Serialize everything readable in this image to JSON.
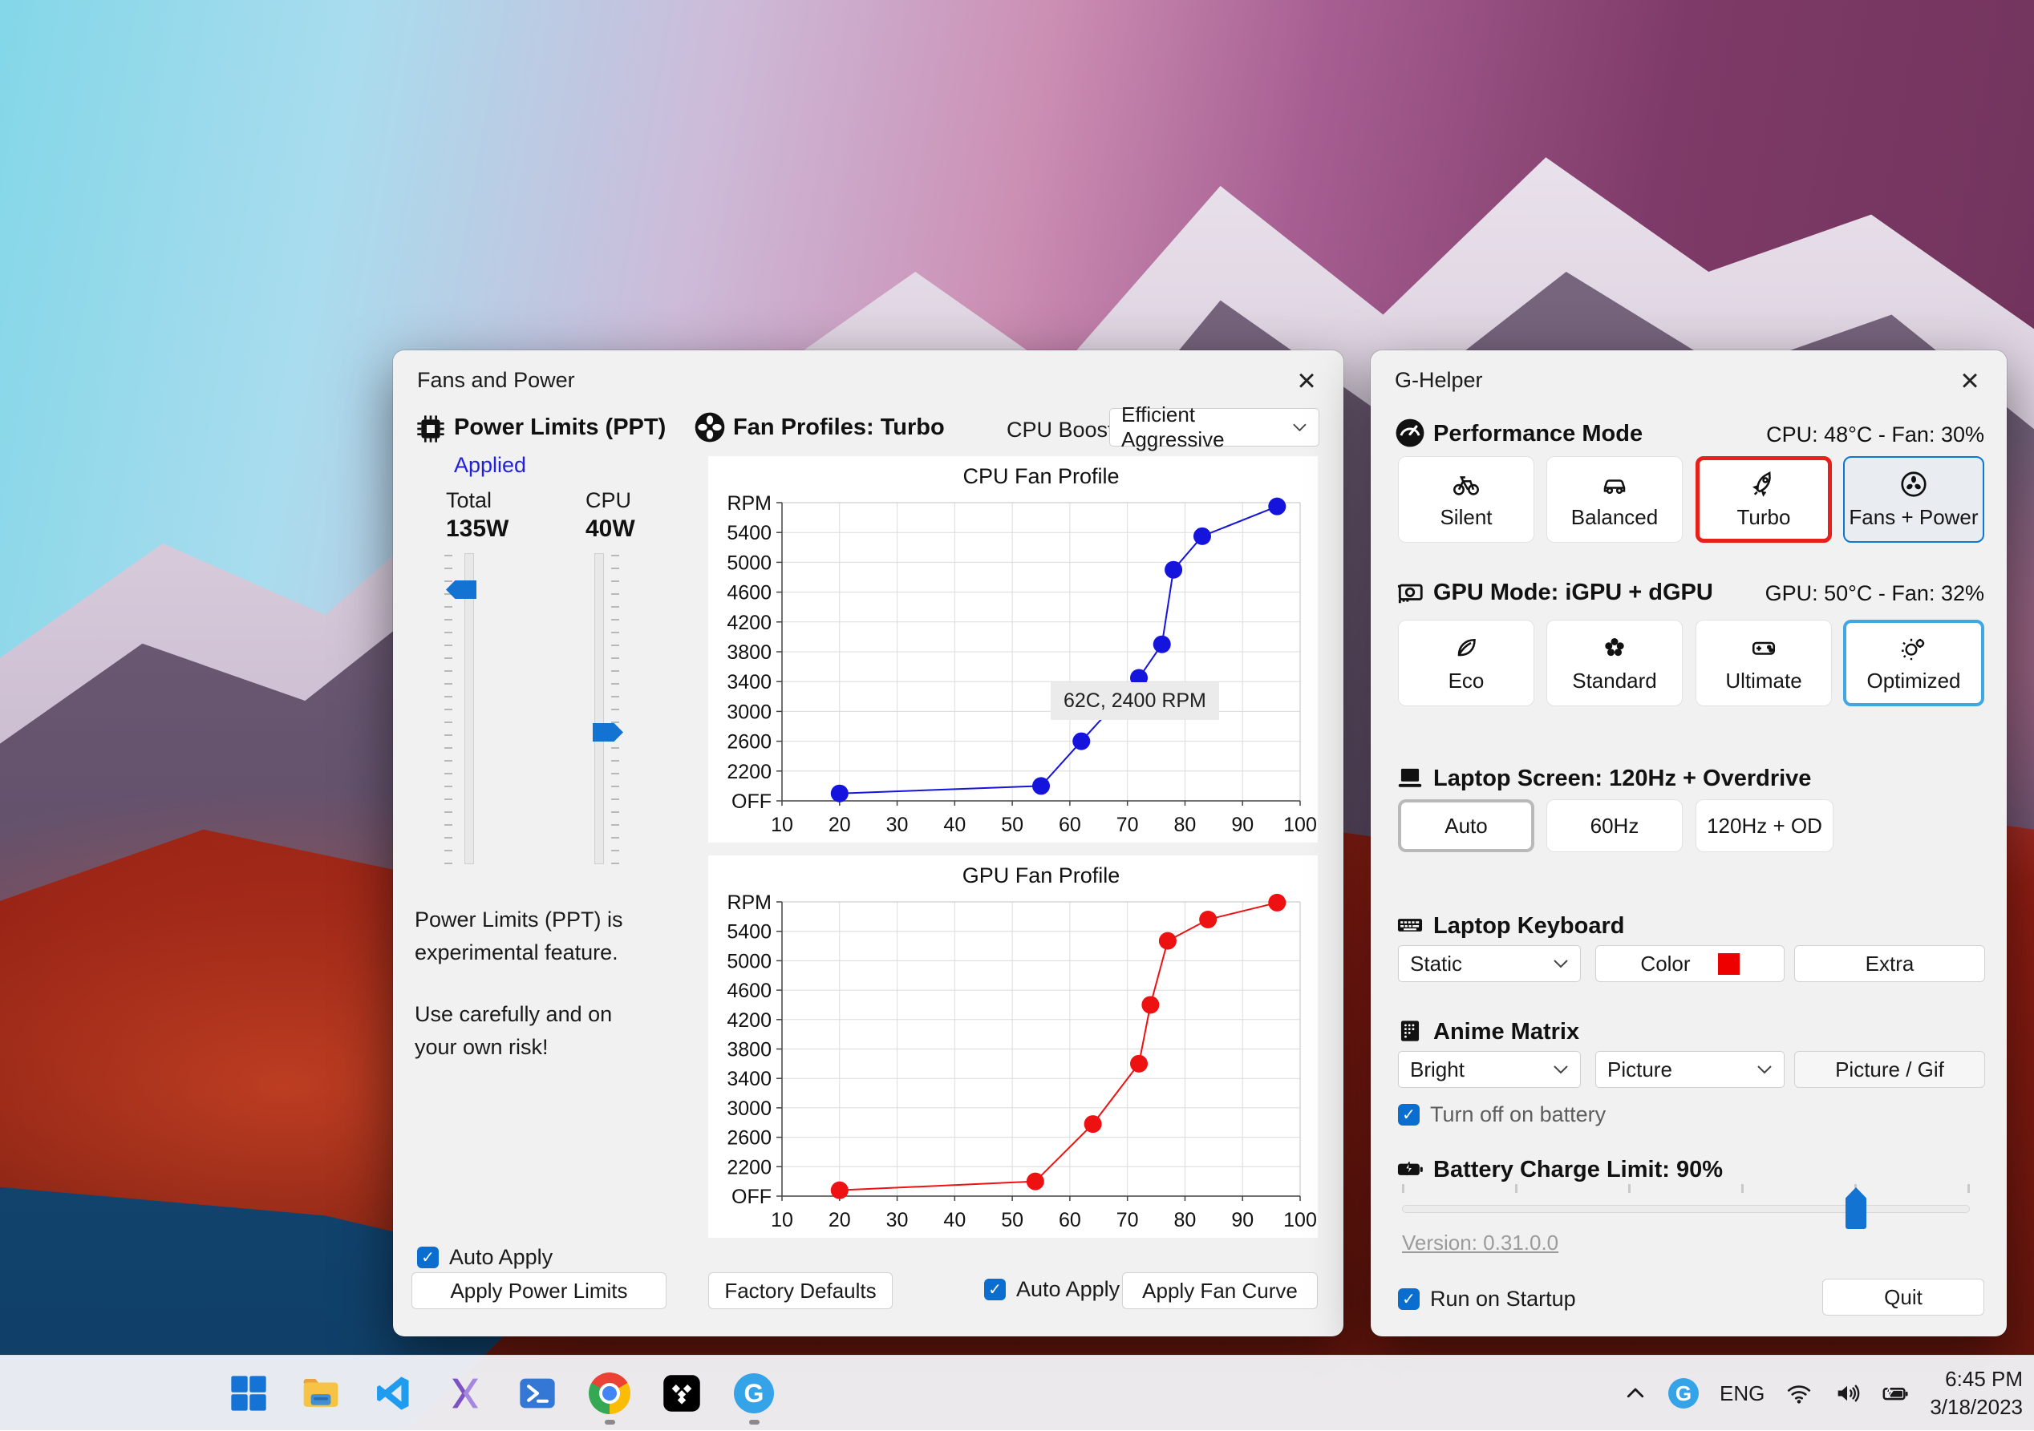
{
  "fans_window": {
    "title": "Fans and Power",
    "close": "×",
    "power_limits": {
      "heading": "Power Limits (PPT)",
      "status": "Applied",
      "total_label": "Total",
      "total_value": "135W",
      "cpu_label": "CPU",
      "cpu_value": "40W",
      "note1": "Power Limits (PPT) is experimental feature.",
      "note2": "Use carefully and on your own risk!",
      "auto_apply_label": "Auto Apply",
      "apply_button": "Apply Power Limits"
    },
    "fan_profiles": {
      "heading": "Fan Profiles: Turbo",
      "cpu_boost_label": "CPU Boost",
      "cpu_boost_value": "Efficient Aggressive",
      "factory_defaults_button": "Factory Defaults",
      "auto_apply_label": "Auto Apply",
      "apply_button": "Apply Fan Curve"
    }
  },
  "chart_data": [
    {
      "type": "line",
      "title": "CPU Fan Profile",
      "color": "#1414dc",
      "x": [
        20,
        55,
        62,
        72,
        76,
        78,
        83,
        96
      ],
      "y": [
        1900,
        2000,
        2600,
        3450,
        3900,
        4900,
        5350,
        5750
      ],
      "xlim": [
        10,
        100
      ],
      "ylim": [
        1800,
        5800
      ],
      "x_ticks": [
        10,
        20,
        30,
        40,
        50,
        60,
        70,
        80,
        90,
        100
      ],
      "y_tick_step": 400,
      "top_label": "RPM",
      "bottom_label": "OFF",
      "grid": true,
      "tooltip": {
        "text": "62C, 2400 RPM"
      }
    },
    {
      "type": "line",
      "title": "GPU Fan Profile",
      "color": "#ee1111",
      "x": [
        20,
        54,
        64,
        72,
        74,
        77,
        84,
        96
      ],
      "y": [
        1880,
        2000,
        2780,
        3600,
        4400,
        5270,
        5560,
        5790
      ],
      "xlim": [
        10,
        100
      ],
      "ylim": [
        1800,
        5800
      ],
      "x_ticks": [
        10,
        20,
        30,
        40,
        50,
        60,
        70,
        80,
        90,
        100
      ],
      "y_tick_step": 400,
      "top_label": "RPM",
      "bottom_label": "OFF",
      "grid": true
    }
  ],
  "ghelper_window": {
    "title": "G-Helper",
    "close": "×",
    "performance": {
      "heading": "Performance Mode",
      "status": "CPU: 48°C -  Fan: 30%",
      "buttons": [
        {
          "label": "Silent",
          "icon": "bicycle-icon"
        },
        {
          "label": "Balanced",
          "icon": "car-icon"
        },
        {
          "label": "Turbo",
          "icon": "rocket-icon",
          "selected": "red-border"
        },
        {
          "label": "Fans + Power",
          "icon": "fan-icon",
          "selected": "blue-border"
        }
      ]
    },
    "gpu": {
      "heading": "GPU Mode: iGPU + dGPU",
      "status": "GPU: 50°C -  Fan: 32%",
      "buttons": [
        {
          "label": "Eco",
          "icon": "leaf-icon"
        },
        {
          "label": "Standard",
          "icon": "flower-icon"
        },
        {
          "label": "Ultimate",
          "icon": "gamepad-icon"
        },
        {
          "label": "Optimized",
          "icon": "bulb-gear-icon",
          "selected": "lightblue-border"
        }
      ]
    },
    "screen": {
      "heading": "Laptop Screen: 120Hz + Overdrive",
      "buttons": [
        {
          "label": "Auto",
          "selected": "gray-border"
        },
        {
          "label": "60Hz"
        },
        {
          "label": "120Hz + OD"
        }
      ]
    },
    "keyboard": {
      "heading": "Laptop Keyboard",
      "mode_value": "Static",
      "color_button": "Color",
      "color_swatch": "#ee0000",
      "extra_button": "Extra"
    },
    "matrix": {
      "heading": "Anime Matrix",
      "brightness_value": "Bright",
      "mode_value": "Picture",
      "picture_button": "Picture / Gif",
      "battery_checkbox": "Turn off on battery"
    },
    "battery": {
      "heading": "Battery Charge Limit: 90%",
      "percent": 90
    },
    "version_link": "Version: 0.31.0.0",
    "startup_checkbox": "Run on Startup",
    "quit_button": "Quit"
  },
  "taskbar": {
    "apps": [
      {
        "icon": "windows-start-icon"
      },
      {
        "icon": "file-explorer-icon"
      },
      {
        "icon": "vscode-icon"
      },
      {
        "icon": "purple-dev-app-icon"
      },
      {
        "icon": "powershell-icon"
      },
      {
        "icon": "chrome-icon",
        "running": true
      },
      {
        "icon": "tidal-icon"
      },
      {
        "icon": "ghelper-icon",
        "running": true
      }
    ],
    "tray": {
      "language": "ENG",
      "time": "6:45 PM",
      "date": "3/18/2023"
    }
  },
  "accent_colors": {
    "windows_blue": "#0a6ed1",
    "turbo_red": "#e8201a",
    "optimized_blue": "#3fa7e6",
    "applied_blue": "#2020dd"
  }
}
